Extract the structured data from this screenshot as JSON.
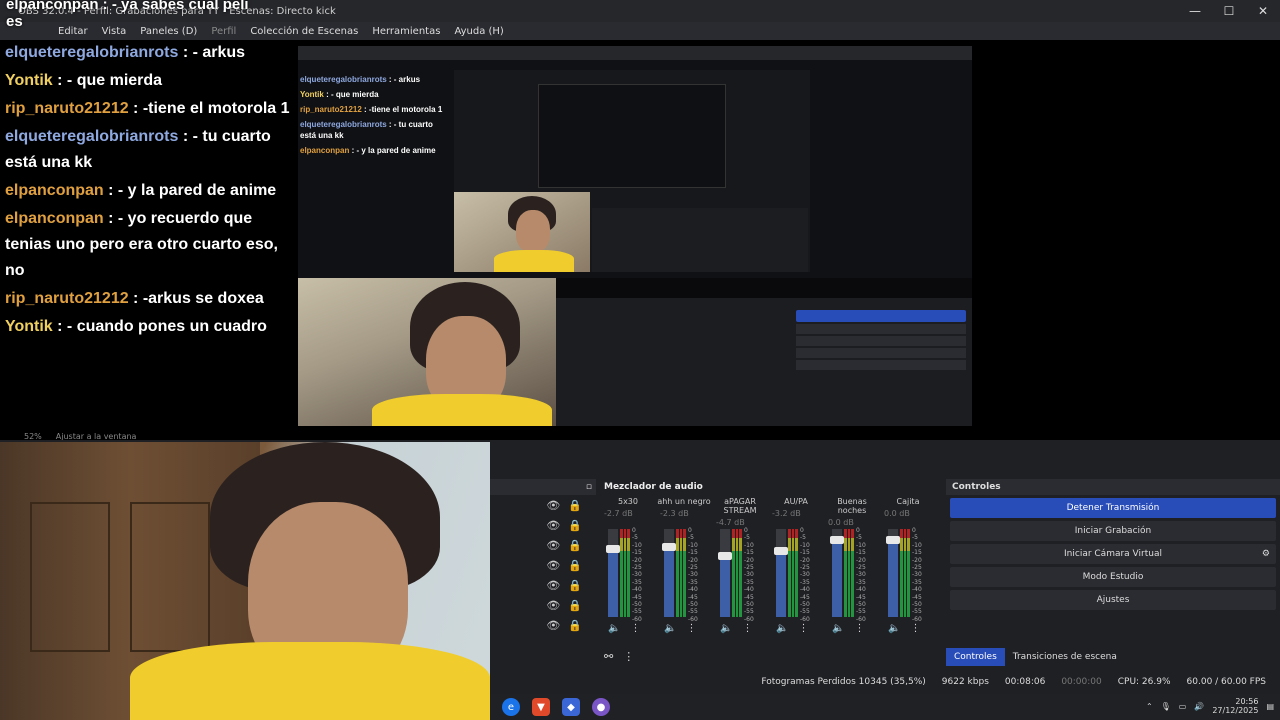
{
  "window": {
    "title": "OBS 32.0.4 - Perfil: Grabaciones para YY - Escenas: Directo kick",
    "overlay_title": "elpanconpan : - ya sabes cual peli es",
    "minimize": "—",
    "maximize": "☐",
    "close": "✕"
  },
  "menu": {
    "items": [
      "Editar",
      "Vista",
      "Paneles (D)",
      "Perfil",
      "Colección de Escenas",
      "Herramientas",
      "Ayuda (H)"
    ]
  },
  "chat": [
    {
      "user": "elqueteregalobrianrots",
      "text": " : - arkus",
      "color": "blue"
    },
    {
      "user": "Yontik",
      "text": " : - que mierda",
      "color": "yellow"
    },
    {
      "user": "rip_naruto21212",
      "text": " : -tiene el motorola 1",
      "color": "orange"
    },
    {
      "user": "elqueteregalobrianrots",
      "text": " : - tu cuarto está una kk",
      "color": "blue"
    },
    {
      "user": "elpanconpan",
      "text": " : - y la pared de anime",
      "color": "orange"
    },
    {
      "user": "elpanconpan",
      "text": " : - yo recuerdo que tenias uno pero era otro cuarto eso, no",
      "color": "orange"
    },
    {
      "user": "rip_naruto21212",
      "text": " : -arkus se doxea",
      "color": "orange"
    },
    {
      "user": "Yontik",
      "text": " : - cuando pones un cuadro",
      "color": "yellow"
    }
  ],
  "zoom": {
    "level": "52%",
    "fit": "Ajustar a la ventana"
  },
  "mixer": {
    "title": "Mezclador de audio",
    "channels": [
      {
        "name": "5x30",
        "db": "-2.7 dB",
        "level": 0.82
      },
      {
        "name": "ahh un negro",
        "db": "-2.3 dB",
        "level": 0.84
      },
      {
        "name": "aPAGAR STREAM",
        "db": "-4.7 dB",
        "level": 0.74
      },
      {
        "name": "AU/PA",
        "db": "-3.2 dB",
        "level": 0.8
      },
      {
        "name": "Buenas noches",
        "db": "0.0 dB",
        "level": 0.92
      },
      {
        "name": "Cajita",
        "db": "0.0 dB",
        "level": 0.92
      }
    ],
    "scale": [
      "0",
      "-5",
      "-10",
      "-15",
      "-20",
      "-25",
      "-30",
      "-35",
      "-40",
      "-45",
      "-50",
      "-55",
      "-60"
    ]
  },
  "controls": {
    "title": "Controles",
    "buttons": [
      "Detener Transmisión",
      "Iniciar Grabación",
      "Iniciar Cámara Virtual",
      "Modo Estudio",
      "Ajustes"
    ],
    "tabs": [
      "Controles",
      "Transiciones de escena"
    ]
  },
  "status": {
    "dropped": "Fotogramas Perdidos 10345 (35,5%)",
    "bitrate": "9622 kbps",
    "stream_time": "00:08:06",
    "rec_time": "00:00:00",
    "cpu": "CPU: 26.9%",
    "fps": "60.00 / 60.00 FPS"
  },
  "taskbar": {
    "time": "20:56",
    "date": "27/12/2025"
  },
  "colors": {
    "accent": "#284cb8",
    "user_blue": "#8ea8e0",
    "user_orange": "#e0a040",
    "user_yellow": "#f0d060",
    "shirt": "#f0cd2c"
  }
}
